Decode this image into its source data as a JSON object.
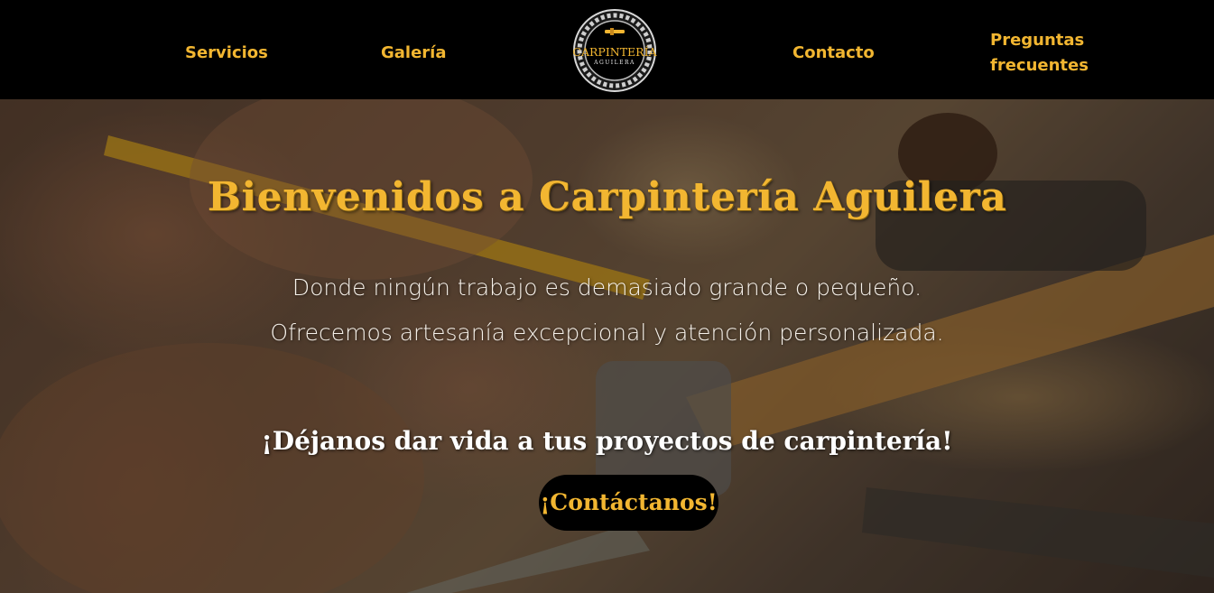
{
  "nav": {
    "services_label": "Servicios",
    "gallery_label": "Galería",
    "contact_label": "Contacto",
    "faq_label": "Preguntas frecuentes"
  },
  "logo": {
    "main_text": "CARPINTERÍA",
    "sub_text": "AGUILERA"
  },
  "hero": {
    "title": "Bienvenidos a Carpintería Aguilera",
    "line1": "Donde ningún trabajo es demasiado grande o pequeño.",
    "line2": "Ofrecemos artesanía excepcional y atención personalizada.",
    "cta_text": "¡Déjanos dar vida a tus proyectos de carpintería!",
    "cta_button": "¡Contáctanos!"
  },
  "colors": {
    "accent": "#f2b631",
    "nav_background": "#000000",
    "hero_text": "#f6f1ea"
  }
}
